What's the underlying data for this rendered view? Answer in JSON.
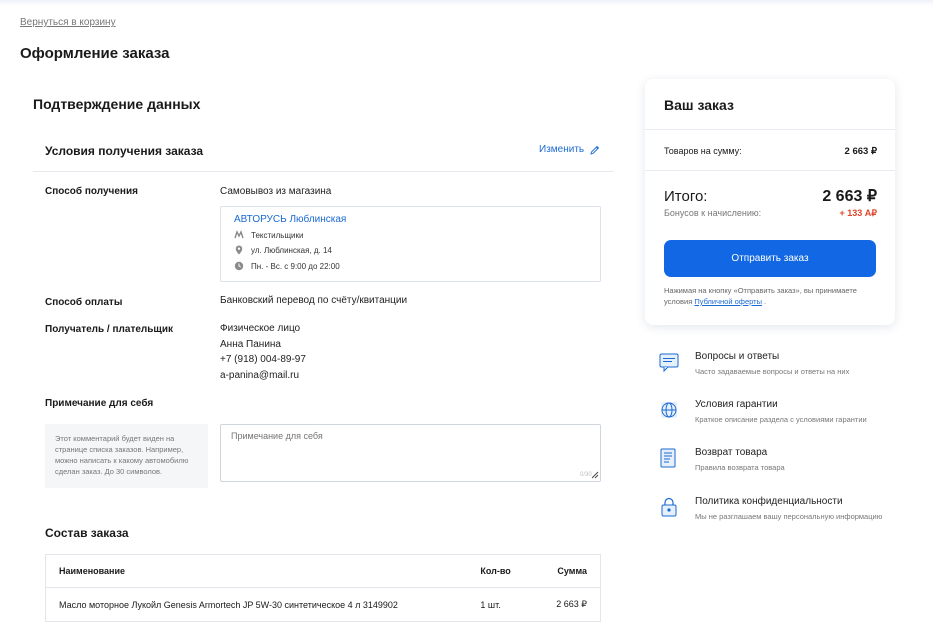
{
  "header": {
    "back_link": "Вернуться в корзину",
    "page_title": "Оформление заказа"
  },
  "confirm": {
    "title": "Подтверждение данных",
    "conditions_title": "Условия получения заказа",
    "change_label": "Изменить",
    "delivery": {
      "label": "Способ получения",
      "value": "Самовывоз из магазина",
      "store": {
        "name": "АВТОРУСЬ Люблинская",
        "metro": "Текстильщики",
        "address": "ул. Люблинская, д. 14",
        "hours": "Пн. - Вс. с 9:00 до 22:00"
      }
    },
    "payment": {
      "label": "Способ оплаты",
      "value": "Банковский перевод по счёту/квитанции"
    },
    "recipient": {
      "label": "Получатель / плательщик",
      "type": "Физическое лицо",
      "name": "Анна Панина",
      "phone": "+7 (918) 004-89-97",
      "email": "a-panina@mail.ru"
    },
    "note": {
      "label": "Примечание для себя",
      "hint": "Этот комментарий будет виден на странице списка заказов. Например, можно написать к какому автомобилю сделан заказ. До 30 символов.",
      "placeholder": "Примечание для себя",
      "counter": "0/30"
    }
  },
  "order": {
    "title": "Состав заказа",
    "columns": [
      "Наименование",
      "Кол-во",
      "Сумма"
    ],
    "rows": [
      {
        "name": "Масло моторное Лукойл Genesis Armortech JP 5W-30 синтетическое 4 л 3149902",
        "qty": "1 шт.",
        "sum": "2 663 ₽"
      }
    ]
  },
  "summary": {
    "title": "Ваш заказ",
    "goods_label": "Товаров на сумму:",
    "goods_value": "2 663 ₽",
    "total_label": "Итого:",
    "total_value": "2 663 ₽",
    "bonus_label": "Бонусов к начислению:",
    "bonus_value": "+ 133 А₽",
    "submit_label": "Отправить заказ",
    "terms_text": "Нажимая на кнопку «Отправить заказ», вы принимаете условия ",
    "terms_link": "Публичной оферты",
    "terms_end": " ."
  },
  "info": [
    {
      "icon": "chat-icon",
      "title": "Вопросы и ответы",
      "desc": "Часто задаваемые вопросы и ответы на них"
    },
    {
      "icon": "globe-icon",
      "title": "Условия гарантии",
      "desc": "Краткое описание раздела с условиями гарантии"
    },
    {
      "icon": "document-icon",
      "title": "Возврат товара",
      "desc": "Правила возврата товара"
    },
    {
      "icon": "lock-icon",
      "title": "Политика конфиденциальности",
      "desc": "Мы не разглашаем вашу персональную информацию"
    }
  ],
  "colors": {
    "accent": "#1268e4",
    "link": "#1b6ad4",
    "bonus": "#e0462b"
  }
}
